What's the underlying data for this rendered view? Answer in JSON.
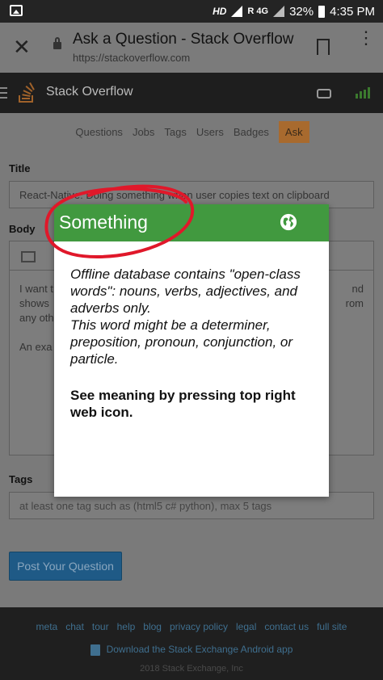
{
  "status_bar": {
    "hd": "HD",
    "network": "R 4G",
    "battery": "32%",
    "time": "4:35 PM"
  },
  "browser": {
    "page_title": "Ask a Question - Stack Overflow",
    "url": "https://stackoverflow.com"
  },
  "site": {
    "name": "Stack Overflow",
    "nav": [
      "Questions",
      "Jobs",
      "Tags",
      "Users",
      "Badges"
    ],
    "nav_active": "Ask"
  },
  "form": {
    "title_label": "Title",
    "title_value": "React-Native: Doing something when user copies text on clipboard",
    "body_label": "Body",
    "body_line1": "I want t",
    "body_line1_right": "nd",
    "body_line2": "shows",
    "body_line2_right": "rom",
    "body_line3": "any oth",
    "body_line4": "An exa",
    "tags_label": "Tags",
    "tags_placeholder": "at least one tag such as (html5 c# python), max 5 tags",
    "post_button": "Post Your Question"
  },
  "popup": {
    "word": "Something",
    "message_line1": "Offline database contains \"open-class words\": nouns, verbs, adjectives, and adverbs only.",
    "message_line2": "This word might be a determiner, preposition, pronoun, conjunction, or particle.",
    "hint": "See meaning by pressing top right web icon."
  },
  "footer": {
    "links": [
      "meta",
      "chat",
      "tour",
      "help",
      "blog",
      "privacy policy",
      "legal",
      "contact us",
      "full site"
    ],
    "download": "Download the Stack Exchange Android app",
    "copyright": "2018 Stack Exchange, Inc"
  },
  "colors": {
    "popup_header": "#41993f",
    "annotation": "#e0182a",
    "ask_tab": "#a86a2e",
    "post_button": "#1f5a86"
  }
}
